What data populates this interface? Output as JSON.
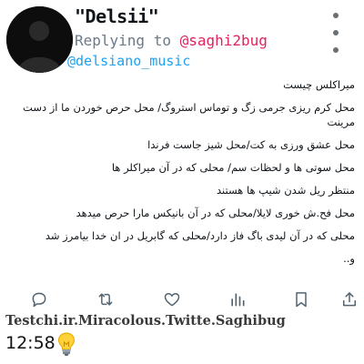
{
  "tweet": {
    "display_name": "\"Delsii\"",
    "reply_prefix": "Replying to ",
    "reply_to_handle": "@saghi2bug",
    "author_handle": "@delsiano_music",
    "lines": [
      "میراکلس چیست",
      "محل کرم ریزی جرمی زگ و توماس استروگ/ محل حرص خوردن ما از دست مرینت",
      "محل عشق ورزی به کت/محل شیز جاست فرندا",
      "محل سوتی ها و لحظات سم/ محلی که در آن میراکلر ها",
      "منتظر ریل شدن شیپ ها هستند",
      "محل فح.ش خوری لایلا/محلی که در آن بانیکس مارا حرص میدهد",
      "محلی که در آن لیدی باگ فاز دارد/محلی که گابریل در ان خدا بیامرز شد",
      "و.."
    ]
  },
  "actions": {
    "reply": "comment-icon",
    "retweet": "retweet-icon",
    "like": "heart-icon",
    "views": "views-icon",
    "bookmark": "bookmark-icon",
    "share": "share-icon"
  },
  "watermark": "Testchi.ir.Miracolous.Twitte.Saghibug",
  "time": "12:58",
  "colors": {
    "handle_blue": "#1da1f2",
    "reply_handle_red": "#e0245e",
    "icon_gray": "#536471"
  }
}
